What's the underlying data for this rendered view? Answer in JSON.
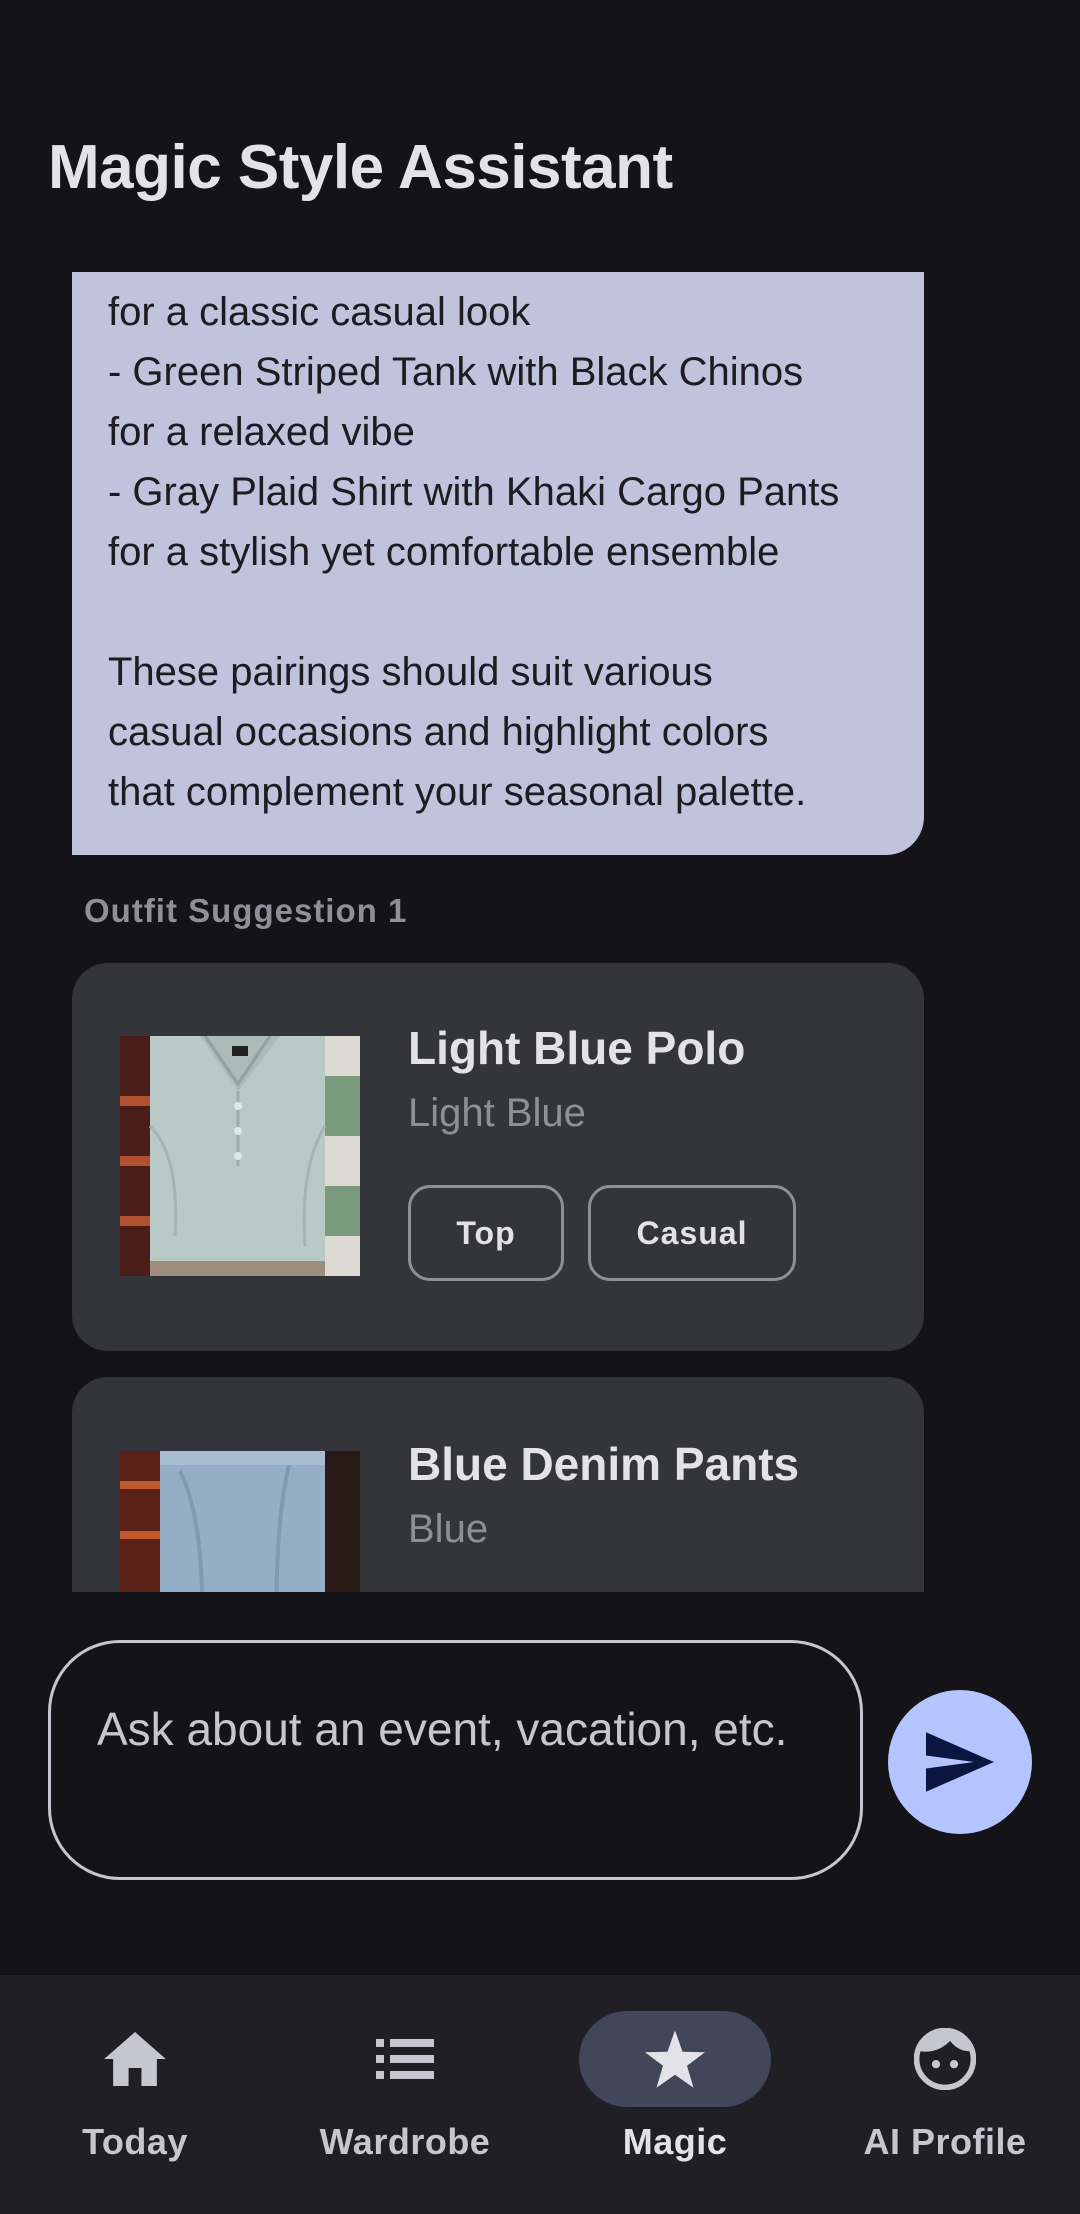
{
  "app": {
    "title": "Magic Style Assistant"
  },
  "chat": {
    "assistant_message": "for a classic casual look\n- Green Striped Tank with Black Chinos\nfor a relaxed vibe\n- Gray Plaid Shirt with Khaki Cargo Pants\nfor a stylish yet comfortable ensemble\n\nThese pairings should suit various\ncasual occasions and highlight colors\nthat complement your seasonal palette."
  },
  "outfit": {
    "label": "Outfit Suggestion 1",
    "items": [
      {
        "name": "Light Blue Polo",
        "color": "Light Blue",
        "tags": [
          "Top",
          "Casual"
        ]
      },
      {
        "name": "Blue Denim Pants",
        "color": "Blue"
      }
    ]
  },
  "input": {
    "placeholder": "Ask about an event, vacation, etc."
  },
  "nav": {
    "items": [
      {
        "label": "Today",
        "icon": "home-icon"
      },
      {
        "label": "Wardrobe",
        "icon": "list-icon"
      },
      {
        "label": "Magic",
        "icon": "star-icon",
        "active": true
      },
      {
        "label": "AI Profile",
        "icon": "face-icon"
      }
    ]
  },
  "colors": {
    "background": "#131318",
    "bubble": "#bfc3db",
    "card": "#34353a",
    "accent": "#b4c4ff",
    "active_pill": "#414659"
  }
}
